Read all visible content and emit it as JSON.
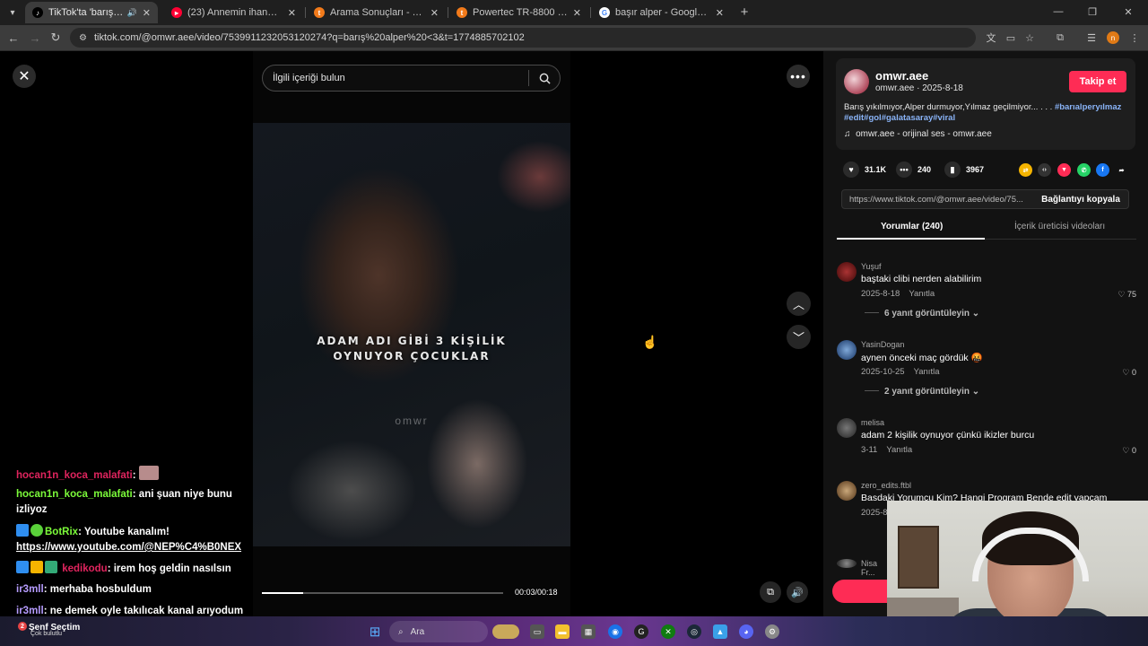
{
  "browser": {
    "tabs": [
      {
        "title": "TikTok'ta 'barış alper <3' bu",
        "active": true,
        "favicon": "tiktok-icon",
        "color": "#ffffff"
      },
      {
        "title": "(23) Annemin ihanetini yakaladı",
        "active": false,
        "favicon": "youtube-icon",
        "color": "#ff0033"
      },
      {
        "title": "Arama Sonuçları - Trendyol",
        "active": false,
        "favicon": "trendyol-icon",
        "color": "#f27a1a"
      },
      {
        "title": "Powertec TR-8800 Profesyonel",
        "active": false,
        "favicon": "trendyol-icon",
        "color": "#f27a1a"
      },
      {
        "title": "başır alper - Google'da Ara",
        "active": false,
        "favicon": "google-icon",
        "color": "#4285f4"
      }
    ],
    "url": "tiktok.com/@omwr.aee/video/7539911232053120274?q=barış%20alper%20<3&t=1774885702102",
    "profile_initial": "n"
  },
  "player": {
    "search_placeholder": "İlgili içeriği bulun",
    "caption_line1": "ADAM ADI GİBİ 3 KİŞİLİK",
    "caption_line2": "OYNUYOR ÇOCUKLAR",
    "watermark": "omwr",
    "time": "00:03/00:18",
    "progress": 0.17
  },
  "chat": [
    {
      "user": "hocan1n_koca_malafati",
      "user_color": "#e0245e",
      "text": "",
      "emote": true
    },
    {
      "user": "hocan1n_koca_malafati",
      "user_color": "#7cfc3a",
      "text": "ani şuan niye bunu izliyoz"
    },
    {
      "user": "BotRix",
      "user_color": "#7cfc3a",
      "text": "Youtube kanalım!",
      "link": "https://www.youtube.com/@NEP%C4%B0NEX"
    },
    {
      "user": "kedikodu",
      "user_color": "#e0245e",
      "text": "irem hoş geldin nasılsın"
    },
    {
      "user": "ir3mll",
      "user_color": "#b69cff",
      "text": "merhaba hosbuldum"
    },
    {
      "user": "ir3mll",
      "user_color": "#b69cff",
      "text": "ne demek oyle takılıcak kanal arıyodum"
    }
  ],
  "post": {
    "username": "omwr.aee",
    "meta": "omwr.aee · 2025-8-18",
    "follow_label": "Takip et",
    "description": "Barış yıkılmıyor,Alper durmuyor,Yılmaz geçilmiyor... . . .",
    "tags": "#barıalperyılmaz #edit#gol#galatasaray#viral",
    "sound": "omwr.aee - orijinal ses - omwr.aee",
    "likes": "31.1K",
    "comments": "240",
    "saves": "3967",
    "link": "https://www.tiktok.com/@omwr.aee/video/75...",
    "copy_label": "Bağlantıyı kopyala",
    "tab_comments": "Yorumlar (240)",
    "tab_creator": "İçerik üreticisi videoları"
  },
  "comments": [
    {
      "user": "Yuşuf",
      "text": "baştaki clibi nerden alabilirim",
      "date": "2025-8-18",
      "reply": "Yanıtla",
      "likes": "75",
      "replies": "6 yanıt görüntüleyin"
    },
    {
      "user": "YasinDogan",
      "text": "aynen önceki maç gördük 🤬",
      "date": "2025-10-25",
      "reply": "Yanıtla",
      "likes": "0",
      "replies": "2 yanıt görüntüleyin"
    },
    {
      "user": "melisa",
      "text": "adam 2 kişilik oynuyor çünkü ikizler burcu",
      "date": "3-11",
      "reply": "Yanıtla",
      "likes": "0",
      "replies": ""
    },
    {
      "user": "zero_edits.ftbl",
      "text": "Basdaki Yorumcu Kim? Hangi Program Bende edit yapcam",
      "date": "2025-8",
      "reply": "",
      "likes": "",
      "replies": ""
    },
    {
      "user": "Nisa Fr...",
      "text": "",
      "date": "",
      "reply": "",
      "likes": "",
      "replies": ""
    }
  ],
  "taskbar": {
    "weather_title": "Çok bulutlu",
    "weather_prefix": "Şenf Seçtim",
    "search_label": "Ara"
  },
  "colors": {
    "accent": "#fe2c55",
    "tag": "#8ab4f8"
  }
}
